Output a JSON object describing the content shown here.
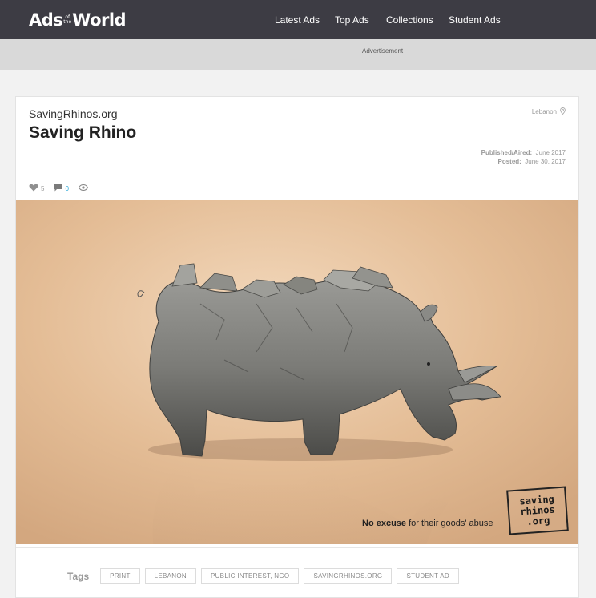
{
  "header": {
    "logo": {
      "left": "Ads",
      "mid_top": "of",
      "mid_bottom": "the",
      "right": "World"
    },
    "nav": [
      {
        "label": "Latest Ads"
      },
      {
        "label": "Top Ads"
      },
      {
        "label": "Collections"
      },
      {
        "label": "Student Ads"
      }
    ]
  },
  "ad_banner": {
    "label": "Advertisement"
  },
  "post": {
    "brand": "SavingRhinos.org",
    "title": "Saving Rhino",
    "location": "Lebanon",
    "published_label": "Published/Aired:",
    "published_value": "June 2017",
    "posted_label": "Posted:",
    "posted_value": "June 30, 2017",
    "likes": "5",
    "comments": "0",
    "icons": {
      "like": "heart-icon",
      "comment": "comment-icon",
      "views": "eye-icon",
      "location": "map-pin-icon"
    }
  },
  "artwork": {
    "tagline_bold": "No excuse",
    "tagline_rest": " for their goods' abuse",
    "stamp_lines": [
      "saving",
      "rhinos",
      ".org"
    ],
    "bg_color": "#e7bf98"
  },
  "tags": {
    "label": "Tags",
    "items": [
      "PRINT",
      "LEBANON",
      "PUBLIC INTEREST, NGO",
      "SAVINGRHINOS.ORG",
      "STUDENT AD"
    ]
  }
}
